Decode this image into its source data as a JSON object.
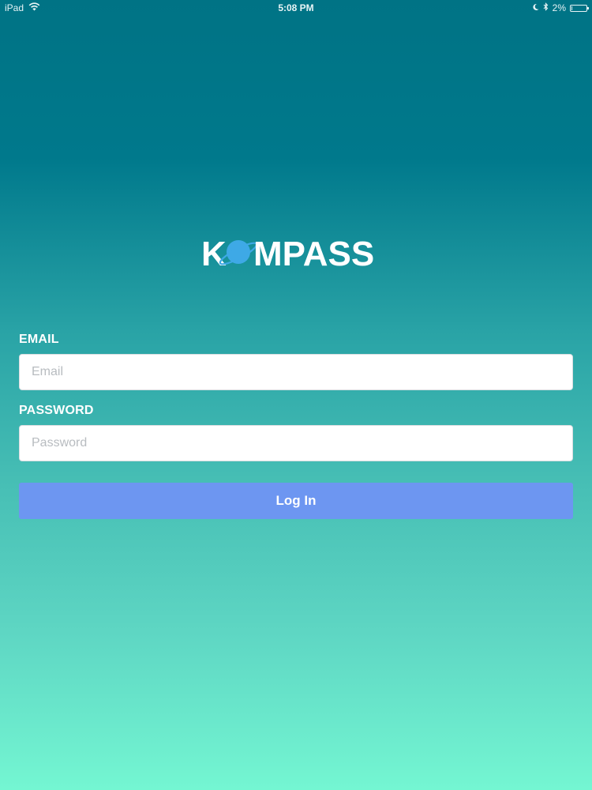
{
  "status_bar": {
    "device": "iPad",
    "time": "5:08 PM",
    "battery_percent": "2%",
    "battery_level": 0.02,
    "icons": [
      "wifi-icon",
      "moon-icon",
      "bluetooth-icon",
      "battery-icon"
    ]
  },
  "logo": {
    "text": "KOMPASS",
    "icon": "planet-icon",
    "planet_color": "#3ea9e6"
  },
  "form": {
    "email_label": "EMAIL",
    "email_placeholder": "Email",
    "email_value": "",
    "password_label": "PASSWORD",
    "password_placeholder": "Password",
    "password_value": "",
    "login_label": "Log In"
  },
  "colors": {
    "gradient_top": "#007385",
    "gradient_bottom": "#74f6d2",
    "button": "#6d96f1"
  }
}
